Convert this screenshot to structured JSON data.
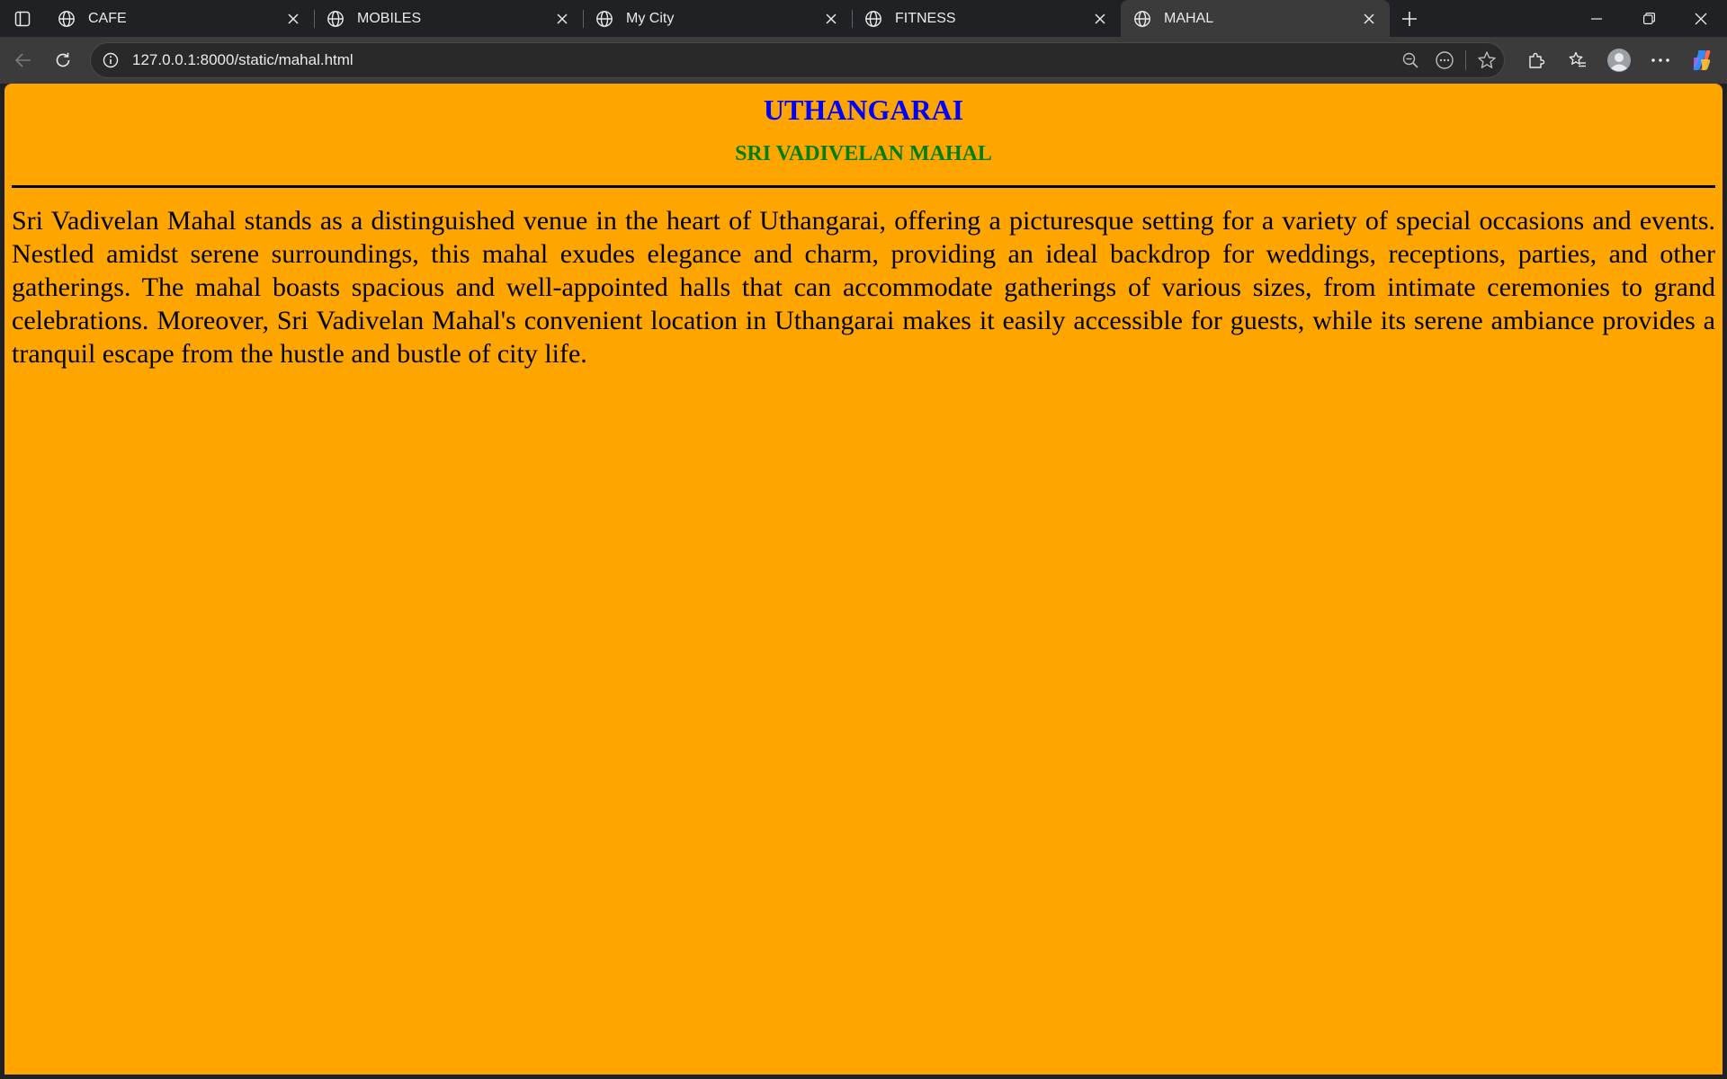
{
  "browser": {
    "tabs": [
      {
        "title": "CAFE",
        "icon": "globe-icon",
        "active": false
      },
      {
        "title": "MOBILES",
        "icon": "globe-icon",
        "active": false
      },
      {
        "title": "My City",
        "icon": "globe-icon",
        "active": false
      },
      {
        "title": "FITNESS",
        "icon": "globe-icon",
        "active": false
      },
      {
        "title": "MAHAL",
        "icon": "globe-icon",
        "active": true
      }
    ],
    "address_bar": {
      "url": "127.0.0.1:8000/static/mahal.html"
    }
  },
  "page": {
    "background_color": "#FFA500",
    "heading": "UTHANGARAI",
    "heading_color": "#0000FF",
    "subheading": "SRI VADIVELAN MAHAL",
    "subheading_color": "#008000",
    "paragraph": "Sri Vadivelan Mahal stands as a distinguished venue in the heart of Uthangarai, offering a picturesque setting for a variety of special occasions and events. Nestled amidst serene surroundings, this mahal exudes elegance and charm, providing an ideal backdrop for weddings, receptions, parties, and other gatherings. The mahal boasts spacious and well-appointed halls that can accommodate gatherings of various sizes, from intimate ceremonies to grand celebrations. Moreover, Sri Vadivelan Mahal's convenient location in Uthangarai makes it easily accessible for guests, while its serene ambiance provides a tranquil escape from the hustle and bustle of city life."
  }
}
